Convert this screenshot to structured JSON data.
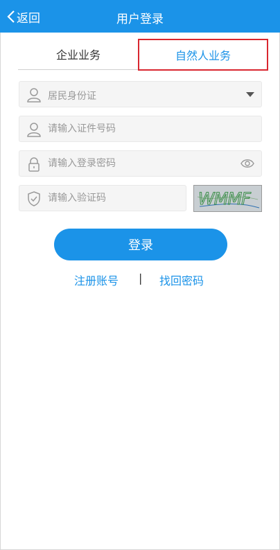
{
  "header": {
    "back_label": "返回",
    "title": "用户登录",
    "background_color": "#1b93e8"
  },
  "tabs": [
    {
      "label": "企业业务",
      "active": false
    },
    {
      "label": "自然人业务",
      "active": true
    }
  ],
  "form": {
    "id_type": {
      "selected": "居民身份证",
      "icon": "user-icon"
    },
    "id_number": {
      "placeholder": "请输入证件号码",
      "value": "",
      "icon": "user-icon"
    },
    "password": {
      "placeholder": "请输入登录密码",
      "value": "",
      "icon": "lock-icon"
    },
    "captcha": {
      "placeholder": "请输入验证码",
      "value": "",
      "icon": "shield-check-icon",
      "image_text": "WMMF"
    }
  },
  "login_button": {
    "label": "登录",
    "color": "#1b93e8"
  },
  "links": {
    "register": "注册账号",
    "separator": "|",
    "forgot": "找回密码"
  },
  "highlight_color": "#d9262f"
}
